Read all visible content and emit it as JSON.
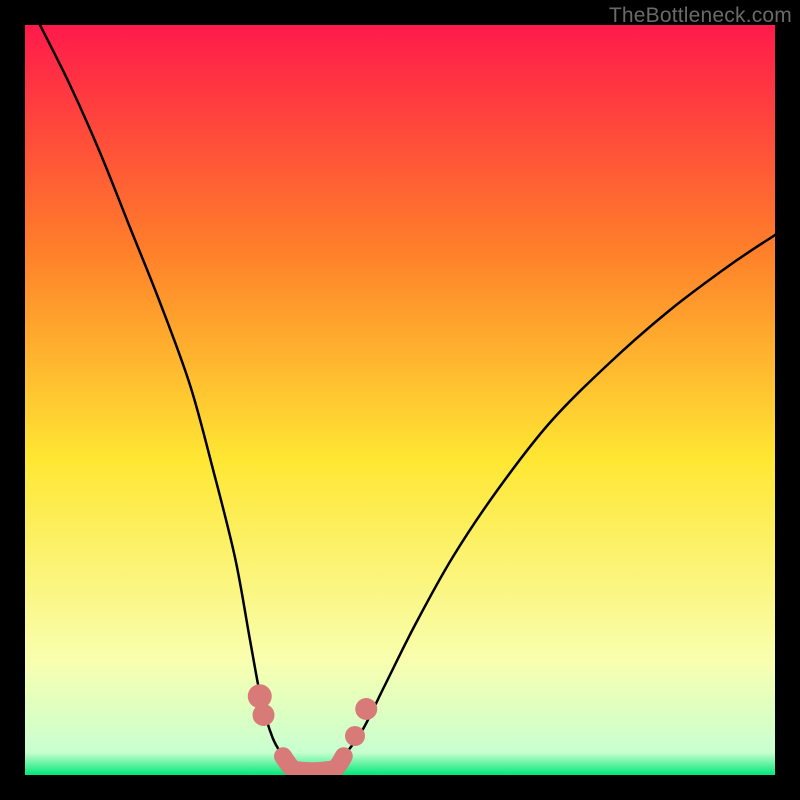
{
  "watermark": "TheBottleneck.com",
  "chart_data": {
    "type": "line",
    "title": "",
    "xlabel": "",
    "ylabel": "",
    "xlim": [
      0,
      100
    ],
    "ylim": [
      0,
      100
    ],
    "gradient_colors": {
      "top": "#ff1a4b",
      "upper_mid": "#ff7f2a",
      "mid": "#ffe733",
      "lower_mid": "#f8ffb0",
      "bottom_edge": "#00e878"
    },
    "series": [
      {
        "name": "left-curve",
        "stroke": "#000000",
        "x": [
          2,
          6,
          10,
          14,
          18,
          22,
          25,
          28,
          30,
          31.5,
          33,
          34.4
        ],
        "y": [
          100,
          92,
          83,
          73,
          63,
          52,
          41,
          29,
          18,
          10,
          5,
          2.5
        ]
      },
      {
        "name": "right-curve",
        "stroke": "#000000",
        "x": [
          42.5,
          45,
          48,
          52,
          57,
          63,
          70,
          78,
          86,
          94,
          100
        ],
        "y": [
          2.5,
          6,
          12,
          20,
          29,
          38,
          47,
          55,
          62,
          68,
          72
        ]
      },
      {
        "name": "valley-floor",
        "stroke": "#d87a78",
        "x": [
          34.4,
          35.5,
          36.5,
          38,
          40,
          41.5,
          42.5
        ],
        "y": [
          2.5,
          1.0,
          0.6,
          0.5,
          0.6,
          1.0,
          2.5
        ]
      }
    ],
    "markers": [
      {
        "x": 31.3,
        "y": 10.5,
        "size": 12,
        "fill": "#d87a78"
      },
      {
        "x": 31.8,
        "y": 8.0,
        "size": 11,
        "fill": "#d87a78"
      },
      {
        "x": 44.0,
        "y": 5.2,
        "size": 10,
        "fill": "#d87a78"
      },
      {
        "x": 45.5,
        "y": 8.8,
        "size": 11,
        "fill": "#d87a78"
      }
    ]
  }
}
